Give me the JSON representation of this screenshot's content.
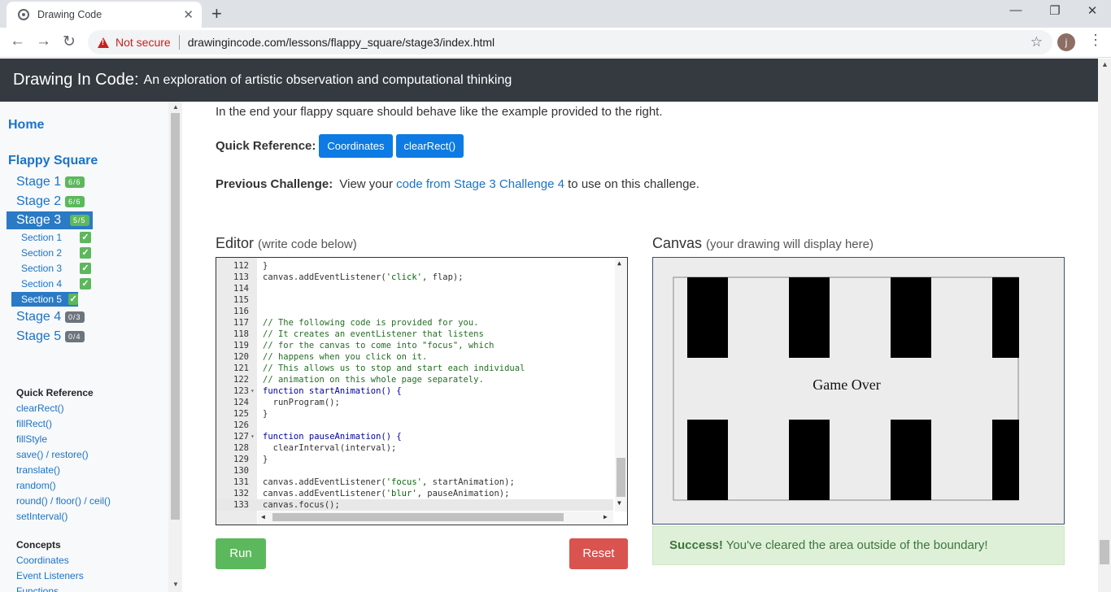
{
  "browser": {
    "tab_title": "Drawing Code",
    "tab_close": "✕",
    "new_tab": "+",
    "security_label": "Not secure",
    "url": "drawingincode.com/lessons/flappy_square/stage3/index.html",
    "avatar_initial": "j",
    "window": {
      "minimize": "—",
      "restore": "❐",
      "close": "✕"
    },
    "nav": {
      "back": "←",
      "forward": "→",
      "reload": "↻"
    },
    "star": "☆",
    "menu": "⋮"
  },
  "header": {
    "title": "Drawing In Code:",
    "subtitle": "An exploration of artistic observation and computational thinking"
  },
  "sidebar": {
    "home": "Home",
    "section_title": "Flappy Square",
    "stages": [
      {
        "label": "Stage 1",
        "badge": "6/6"
      },
      {
        "label": "Stage 2",
        "badge": "6/6"
      },
      {
        "label": "Stage 3",
        "badge": "5/5"
      },
      {
        "label": "Stage 4",
        "badge": "0/3"
      },
      {
        "label": "Stage 5",
        "badge": "0/4"
      }
    ],
    "sections": [
      {
        "label": "Section 1",
        "check": "✓"
      },
      {
        "label": "Section 2",
        "check": "✓"
      },
      {
        "label": "Section 3",
        "check": "✓"
      },
      {
        "label": "Section 4",
        "check": "✓"
      },
      {
        "label": "Section 5",
        "check": "✓"
      }
    ],
    "quick_reference_heading": "Quick Reference",
    "quick_reference": [
      "clearRect()",
      "fillRect()",
      "fillStyle",
      "save() / restore()",
      "translate()",
      "random()",
      "round() / floor() / ceil()",
      "setInterval()"
    ],
    "concepts_heading": "Concepts",
    "concepts": [
      "Coordinates",
      "Event Listeners",
      "Functions"
    ]
  },
  "main": {
    "intro": "In the end your flappy square should behave like the example provided to the right.",
    "quick_ref_label": "Quick Reference:",
    "quick_ref_buttons": [
      "Coordinates",
      "clearRect()"
    ],
    "prev_label": "Previous Challenge:",
    "prev_before": "View your",
    "prev_link": "code from Stage 3 Challenge 4",
    "prev_after": "to use on this challenge.",
    "editor_title": "Editor",
    "editor_sub": "(write code below)",
    "canvas_title": "Canvas",
    "canvas_sub": "(your drawing will display here)",
    "game_over": "Game Over",
    "run_label": "Run",
    "reset_label": "Reset",
    "success_bold": "Success!",
    "success_text": "You've cleared the area outside of the boundary!"
  },
  "editor": {
    "lines": [
      {
        "n": "112",
        "t": "}",
        "k": "plain",
        "fold": ""
      },
      {
        "n": "113",
        "t": "canvas.addEventListener('click', flap);",
        "k": "plain",
        "fold": ""
      },
      {
        "n": "114",
        "t": "",
        "k": "plain",
        "fold": ""
      },
      {
        "n": "115",
        "t": "",
        "k": "plain",
        "fold": ""
      },
      {
        "n": "116",
        "t": "",
        "k": "plain",
        "fold": ""
      },
      {
        "n": "117",
        "t": "// The following code is provided for you.",
        "k": "comment",
        "fold": ""
      },
      {
        "n": "118",
        "t": "// It creates an eventListener that listens",
        "k": "comment",
        "fold": ""
      },
      {
        "n": "119",
        "t": "// for the canvas to come into \"focus\", which",
        "k": "comment",
        "fold": ""
      },
      {
        "n": "120",
        "t": "// happens when you click on it.",
        "k": "comment",
        "fold": ""
      },
      {
        "n": "121",
        "t": "// This allows us to stop and start each individual",
        "k": "comment",
        "fold": ""
      },
      {
        "n": "122",
        "t": "// animation on this whole page separately.",
        "k": "comment",
        "fold": ""
      },
      {
        "n": "123",
        "t": "function startAnimation() {",
        "k": "func",
        "fold": "▾"
      },
      {
        "n": "124",
        "t": "  runProgram();",
        "k": "plain",
        "fold": ""
      },
      {
        "n": "125",
        "t": "}",
        "k": "plain",
        "fold": ""
      },
      {
        "n": "126",
        "t": "",
        "k": "plain",
        "fold": ""
      },
      {
        "n": "127",
        "t": "function pauseAnimation() {",
        "k": "func",
        "fold": "▾"
      },
      {
        "n": "128",
        "t": "  clearInterval(interval);",
        "k": "plain",
        "fold": ""
      },
      {
        "n": "129",
        "t": "}",
        "k": "plain",
        "fold": ""
      },
      {
        "n": "130",
        "t": "",
        "k": "plain",
        "fold": ""
      },
      {
        "n": "131",
        "t": "canvas.addEventListener('focus', startAnimation);",
        "k": "plain",
        "fold": ""
      },
      {
        "n": "132",
        "t": "canvas.addEventListener('blur', pauseAnimation);",
        "k": "plain",
        "fold": ""
      },
      {
        "n": "133",
        "t": "canvas.focus();",
        "k": "plain",
        "fold": ""
      }
    ],
    "current_line": "133"
  },
  "colors": {
    "header_bg": "#343a40",
    "link": "#1a73c8",
    "active_nav": "#2a7ac5",
    "badge_green": "#5cb85c",
    "badge_grey": "#6c757d",
    "run": "#5cb85c",
    "reset": "#d9534f",
    "success_bg": "#dff0d8",
    "pipe": "#000000"
  },
  "icons": {
    "tab_favicon": "globe-icon",
    "warning": "warning-triangle-icon",
    "bookmark": "star-icon",
    "check": "check-icon"
  }
}
